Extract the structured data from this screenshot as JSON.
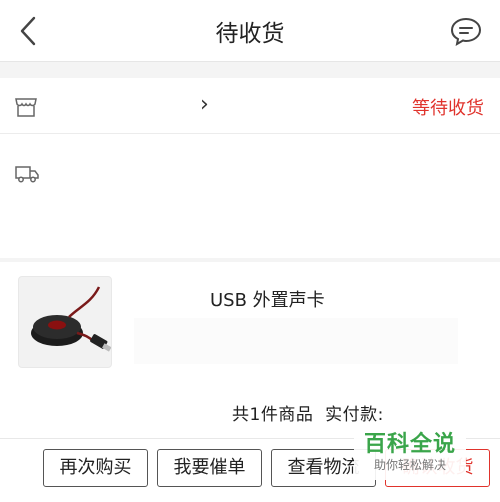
{
  "header": {
    "title": "待收货",
    "back_icon": "chevron-left-icon",
    "message_icon": "chat-bubble-icon"
  },
  "shop": {
    "store_icon": "store-icon",
    "chevron": "›",
    "status": "等待收货"
  },
  "logistics": {
    "icon": "truck-icon"
  },
  "product": {
    "name": "USB 外置声卡"
  },
  "summary": {
    "text": "共1件商品  实付款:"
  },
  "actions": {
    "buy_again": "再次购买",
    "urge": "我要催单",
    "view_logistics": "查看物流",
    "confirm": "确认收货"
  },
  "watermark": {
    "title": "百科全说",
    "subtitle": "助你轻松解决"
  },
  "colors": {
    "accent": "#e0332c",
    "watermark": "#3aa54a"
  }
}
